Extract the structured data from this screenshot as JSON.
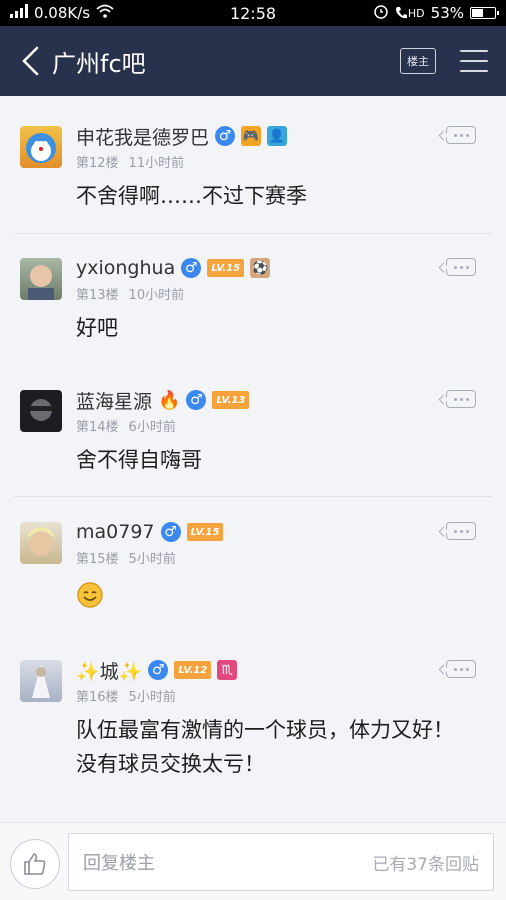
{
  "status": {
    "speed": "0.08K/s",
    "time": "12:58",
    "battery_text": "53%",
    "battery_level": 0.53,
    "net": "HD"
  },
  "nav": {
    "title": "广州fc吧",
    "louzhu_label": "楼主"
  },
  "posts": [
    {
      "username": "申花我是德罗巴",
      "floor": "第12楼",
      "time": "11小时前",
      "content": "不舍得啊……不过下赛季",
      "level": ""
    },
    {
      "username": "yxionghua",
      "floor": "第13楼",
      "time": "10小时前",
      "content": "好吧",
      "level": "LV.15"
    },
    {
      "username": "蓝海星源",
      "floor": "第14楼",
      "time": "6小时前",
      "content": "舍不得自嗨哥",
      "level": "LV.13"
    },
    {
      "username": "ma0797",
      "floor": "第15楼",
      "time": "5小时前",
      "content": "",
      "level": "LV.15"
    },
    {
      "username": "✨城✨",
      "floor": "第16楼",
      "time": "5小时前",
      "content": "队伍最富有激情的一个球员，体力又好！没有球员交换太亏！",
      "level": "LV.12"
    }
  ],
  "bottom": {
    "reply_placeholder": "回复楼主",
    "reply_count": "已有37条回贴"
  },
  "colors": {
    "nav_bg": "#28324c",
    "level_badge": "#f6a23d",
    "male_badge": "#3a88f0"
  }
}
